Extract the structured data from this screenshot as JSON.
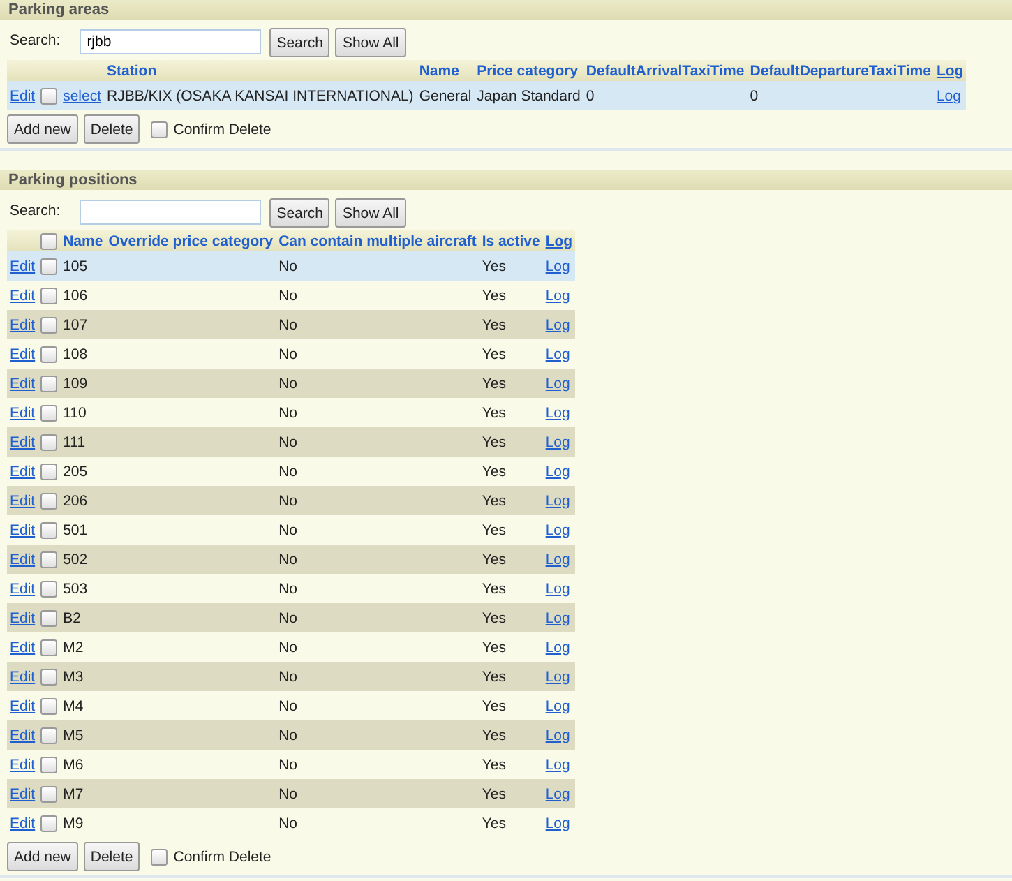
{
  "areas": {
    "title": "Parking areas",
    "search": {
      "label": "Search:",
      "value": "rjbb",
      "button": "Search",
      "show_all": "Show All"
    },
    "columns": [
      "Station",
      "Name",
      "Price category",
      "DefaultArrivalTaxiTime",
      "DefaultDepartureTaxiTime",
      "Log"
    ],
    "rows": [
      {
        "edit": "Edit",
        "checked": false,
        "select": "select",
        "station": "RJBB/KIX (OSAKA KANSAI INTERNATIONAL)",
        "name": "General",
        "price_category": "Japan Standard",
        "arrival": "0",
        "departure": "0",
        "log": "Log",
        "selected": true
      }
    ],
    "add_new": "Add new",
    "delete": "Delete",
    "confirm": {
      "label": "Confirm Delete",
      "checked": false
    }
  },
  "positions": {
    "title": "Parking positions",
    "search": {
      "label": "Search:",
      "button": "Search",
      "show_all": "Show All"
    },
    "header_checked": false,
    "columns": [
      "Name",
      "Override price category",
      "Can contain multiple aircraft",
      "Is active",
      "Log"
    ],
    "rows": [
      {
        "edit": "Edit",
        "name": "105",
        "multiple": "No",
        "active": "Yes",
        "log": "Log",
        "checked": false,
        "selected": true
      },
      {
        "edit": "Edit",
        "name": "106",
        "multiple": "No",
        "active": "Yes",
        "log": "Log",
        "checked": false,
        "selected": false
      },
      {
        "edit": "Edit",
        "name": "107",
        "multiple": "No",
        "active": "Yes",
        "log": "Log",
        "checked": false,
        "selected": false
      },
      {
        "edit": "Edit",
        "name": "108",
        "multiple": "No",
        "active": "Yes",
        "log": "Log",
        "checked": false,
        "selected": false
      },
      {
        "edit": "Edit",
        "name": "109",
        "multiple": "No",
        "active": "Yes",
        "log": "Log",
        "checked": false,
        "selected": false
      },
      {
        "edit": "Edit",
        "name": "110",
        "multiple": "No",
        "active": "Yes",
        "log": "Log",
        "checked": false,
        "selected": false
      },
      {
        "edit": "Edit",
        "name": "111",
        "multiple": "No",
        "active": "Yes",
        "log": "Log",
        "checked": false,
        "selected": false
      },
      {
        "edit": "Edit",
        "name": "205",
        "multiple": "No",
        "active": "Yes",
        "log": "Log",
        "checked": false,
        "selected": false
      },
      {
        "edit": "Edit",
        "name": "206",
        "multiple": "No",
        "active": "Yes",
        "log": "Log",
        "checked": false,
        "selected": false
      },
      {
        "edit": "Edit",
        "name": "501",
        "multiple": "No",
        "active": "Yes",
        "log": "Log",
        "checked": false,
        "selected": false
      },
      {
        "edit": "Edit",
        "name": "502",
        "multiple": "No",
        "active": "Yes",
        "log": "Log",
        "checked": false,
        "selected": false
      },
      {
        "edit": "Edit",
        "name": "503",
        "multiple": "No",
        "active": "Yes",
        "log": "Log",
        "checked": false,
        "selected": false
      },
      {
        "edit": "Edit",
        "name": "B2",
        "multiple": "No",
        "active": "Yes",
        "log": "Log",
        "checked": false,
        "selected": false
      },
      {
        "edit": "Edit",
        "name": "M2",
        "multiple": "No",
        "active": "Yes",
        "log": "Log",
        "checked": false,
        "selected": false
      },
      {
        "edit": "Edit",
        "name": "M3",
        "multiple": "No",
        "active": "Yes",
        "log": "Log",
        "checked": false,
        "selected": false
      },
      {
        "edit": "Edit",
        "name": "M4",
        "multiple": "No",
        "active": "Yes",
        "log": "Log",
        "checked": false,
        "selected": false
      },
      {
        "edit": "Edit",
        "name": "M5",
        "multiple": "No",
        "active": "Yes",
        "log": "Log",
        "checked": false,
        "selected": false
      },
      {
        "edit": "Edit",
        "name": "M6",
        "multiple": "No",
        "active": "Yes",
        "log": "Log",
        "checked": false,
        "selected": false
      },
      {
        "edit": "Edit",
        "name": "M7",
        "multiple": "No",
        "active": "Yes",
        "log": "Log",
        "checked": false,
        "selected": false
      },
      {
        "edit": "Edit",
        "name": "M9",
        "multiple": "No",
        "active": "Yes",
        "log": "Log",
        "checked": false,
        "selected": false
      }
    ],
    "add_new": "Add new",
    "delete": "Delete",
    "confirm": {
      "label": "Confirm Delete",
      "checked": false
    }
  }
}
